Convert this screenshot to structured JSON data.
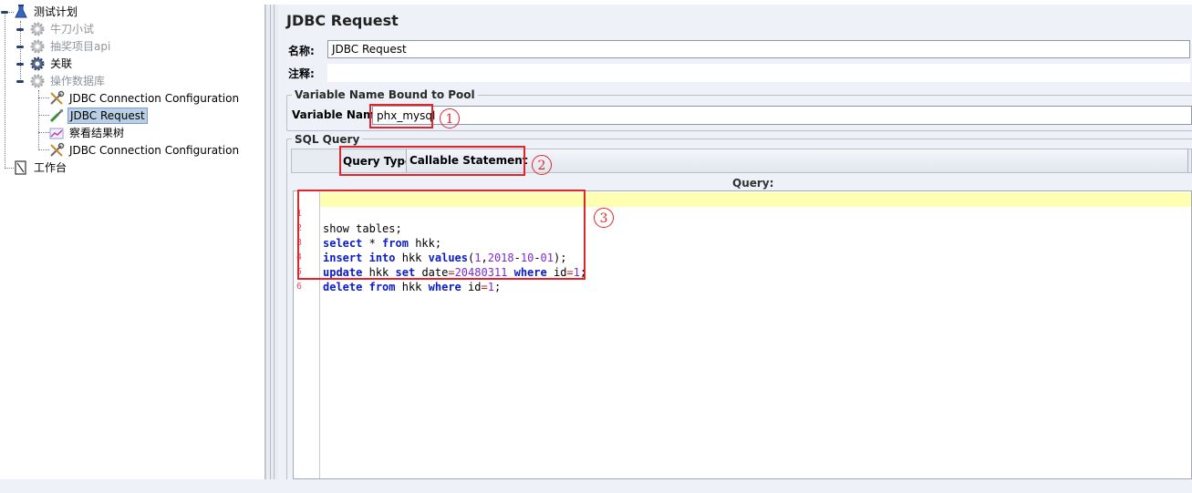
{
  "tree": {
    "root": "测试计划",
    "items": [
      {
        "label": "牛刀小试",
        "disabled": true
      },
      {
        "label": "抽奖项目api",
        "disabled": true
      },
      {
        "label": "关联",
        "disabled": false
      },
      {
        "label": "操作数据库",
        "disabled": true
      }
    ],
    "children": [
      {
        "label": "JDBC Connection Configuration"
      },
      {
        "label": "JDBC Request",
        "selected": true
      },
      {
        "label": "察看结果树"
      },
      {
        "label": "JDBC Connection Configuration"
      }
    ],
    "workbench": "工作台"
  },
  "panel": {
    "title": "JDBC Request",
    "name_label": "名称:",
    "name_value": "JDBC Request",
    "comment_label": "注释:",
    "pool_legend": "Variable Name Bound to Pool",
    "variable_name_label": "Variable Name",
    "variable_name_value": "phx_mysql",
    "sql_legend": "SQL Query",
    "query_type_label": "Query Type:",
    "query_type_value": "Callable Statement",
    "query_label": "Query:"
  },
  "editor": {
    "line_numbers": [
      "1",
      "2",
      "3",
      "4",
      "5",
      "6"
    ],
    "lines": [
      "show tables;",
      "select * from hkk;",
      "insert into hkk values(1,2018-10-01);",
      "update hkk set date=20480311 where id=1;",
      "delete from hkk where id=1;",
      ""
    ]
  },
  "annotations": {
    "marker_1": "1",
    "marker_2": "2",
    "marker_3": "3"
  },
  "colors": {
    "keyword": "#0a1cc8",
    "number": "#7a2bd0",
    "annotation": "#e0262c",
    "current_line": "#ffffb2",
    "selection": "#b8cfe5"
  }
}
